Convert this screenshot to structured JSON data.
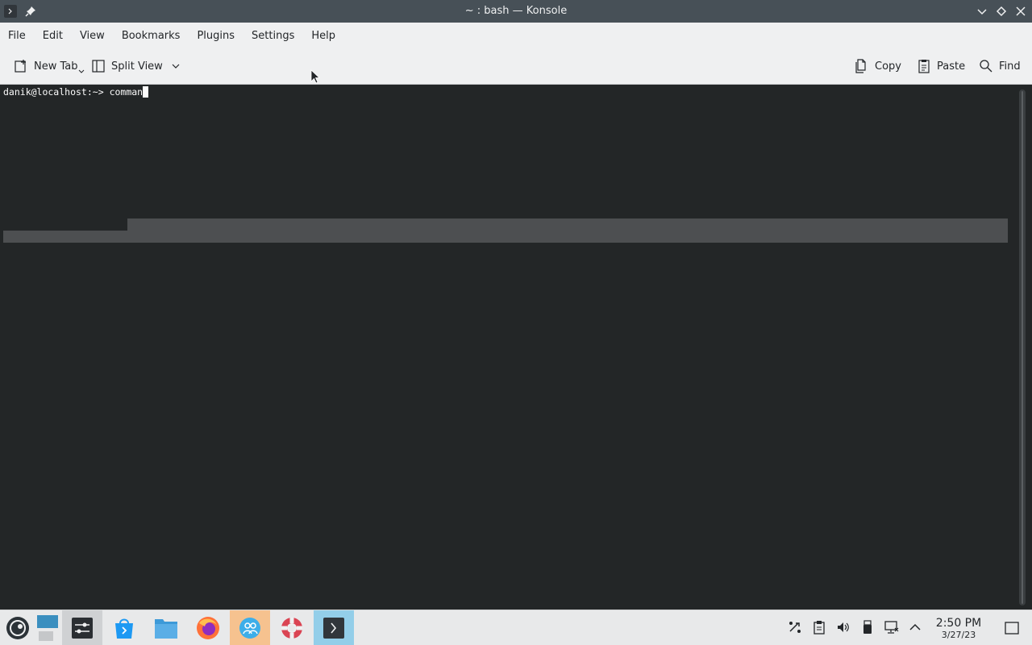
{
  "window": {
    "title": "~ : bash — Konsole"
  },
  "menubar": {
    "items": [
      "File",
      "Edit",
      "View",
      "Bookmarks",
      "Plugins",
      "Settings",
      "Help"
    ]
  },
  "toolbar": {
    "new_tab": "New Tab",
    "split_view": "Split View",
    "copy": "Copy",
    "paste": "Paste",
    "find": "Find"
  },
  "terminal": {
    "prompt": "danik@localhost:~> ",
    "input": "comman"
  },
  "taskbar": {
    "time": "2:50 PM",
    "date": "3/27/23",
    "apps": [
      "application-launcher-icon",
      "desktop-pager-icon",
      "system-settings-icon",
      "software-store-icon",
      "file-manager-icon",
      "firefox-icon",
      "community-icon",
      "help-lifebuoy-icon",
      "konsole-icon"
    ]
  },
  "colors": {
    "terminal_bg": "#232627",
    "titlebar_bg": "#475057",
    "selection": "#4d4f51",
    "chrome_bg": "#eff0f1"
  }
}
